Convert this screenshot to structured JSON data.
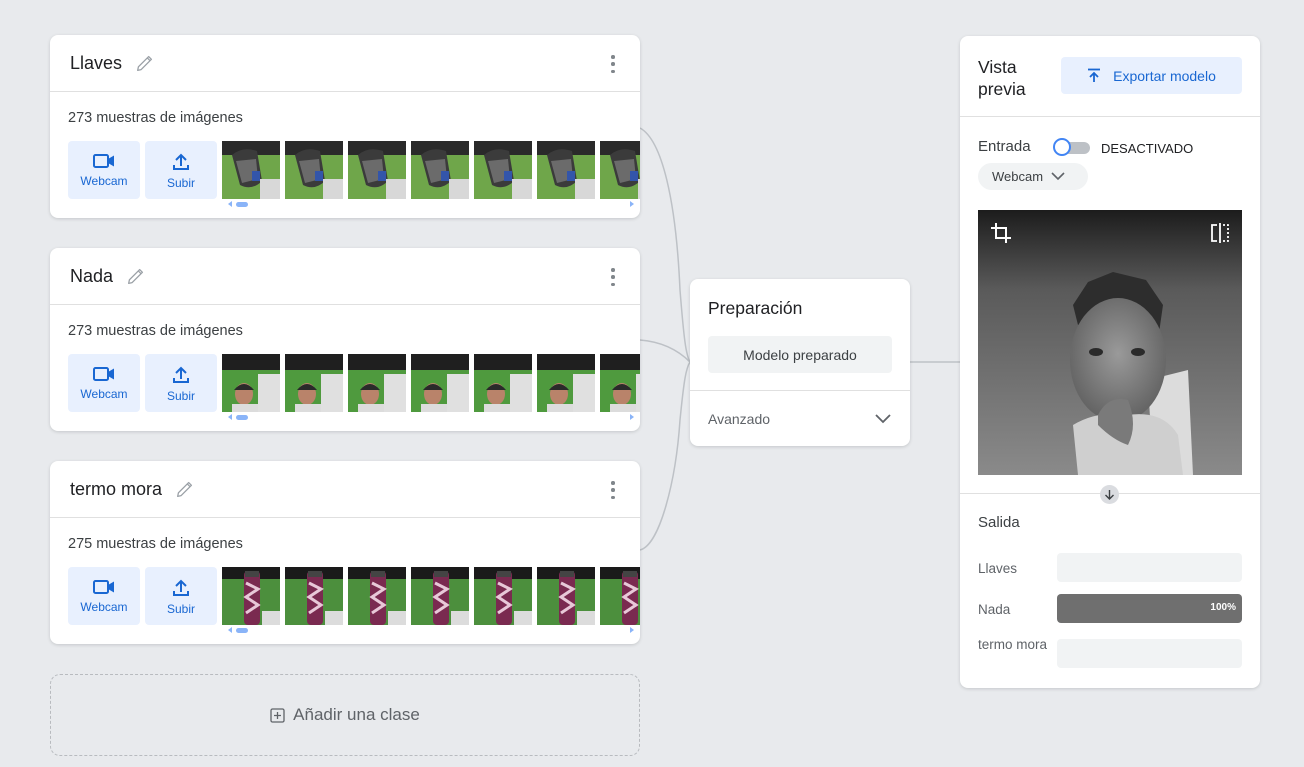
{
  "classes": [
    {
      "name": "Llaves",
      "samples": "273 muestras de imágenes",
      "webcam_label": "Webcam",
      "upload_label": "Subir",
      "thumb_kind": "keys"
    },
    {
      "name": "Nada",
      "samples": "273 muestras de imágenes",
      "webcam_label": "Webcam",
      "upload_label": "Subir",
      "thumb_kind": "person"
    },
    {
      "name": "termo mora",
      "samples": "275 muestras de imágenes",
      "webcam_label": "Webcam",
      "upload_label": "Subir",
      "thumb_kind": "bottle"
    }
  ],
  "add_class_label": "Añadir una clase",
  "training": {
    "title": "Preparación",
    "button_label": "Modelo preparado",
    "advanced_label": "Avanzado"
  },
  "preview": {
    "title": "Vista previa",
    "export_label": "Exportar modelo",
    "input_label": "Entrada",
    "toggle_state": "DESACTIVADO",
    "source_value": "Webcam",
    "output_label": "Salida",
    "outputs": [
      {
        "label": "Llaves",
        "value": 0,
        "pct_text": ""
      },
      {
        "label": "Nada",
        "value": 1.0,
        "pct_text": "100%"
      },
      {
        "label": "termo mora",
        "value": 0,
        "pct_text": ""
      }
    ]
  },
  "icons": {
    "edit": "pencil-icon",
    "more": "more-vert-icon",
    "webcam": "videocam-icon",
    "upload": "upload-icon",
    "add": "add-box-icon",
    "export": "upload-icon",
    "source": "chevron-down-icon",
    "crop": "crop-icon",
    "flip": "flip-icon",
    "arrow": "arrow-down-icon"
  },
  "colors": {
    "accent": "#1967d2",
    "accent_light": "#e8f0fe",
    "bar_fill": "#6f6f6f"
  }
}
